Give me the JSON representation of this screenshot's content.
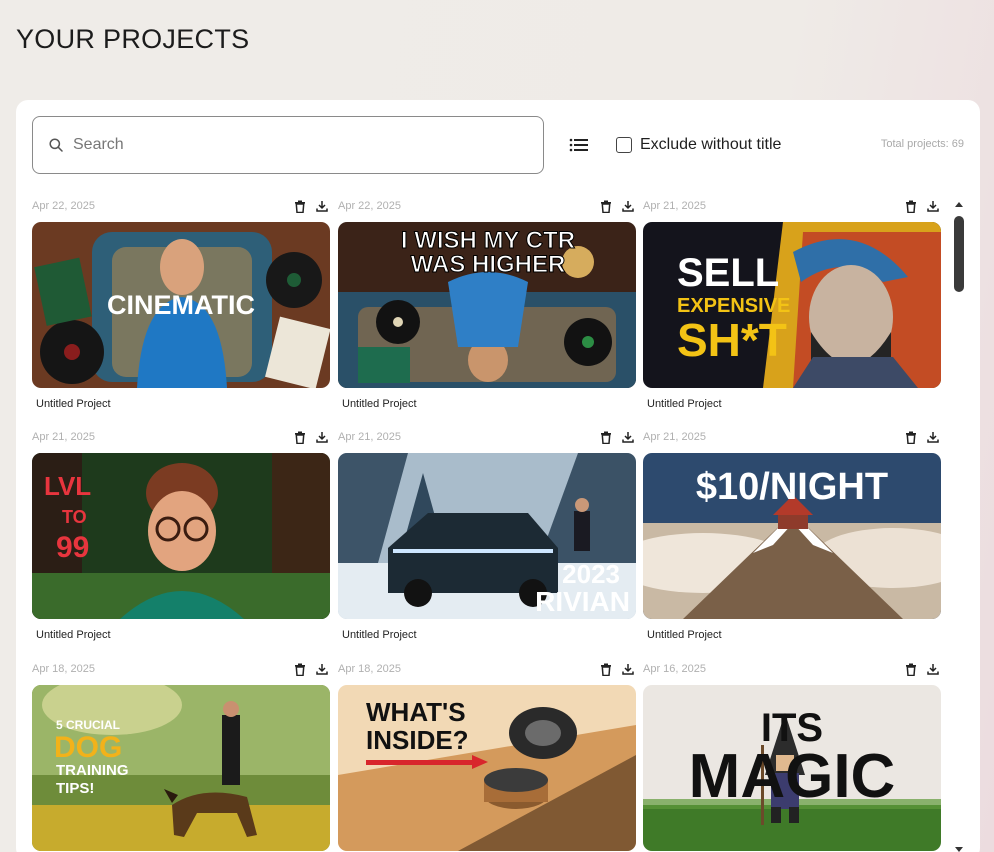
{
  "page": {
    "title": "YOUR PROJECTS"
  },
  "toolbar": {
    "search_placeholder": "Search",
    "exclude_label": "Exclude without title",
    "total_label": "Total projects:",
    "total_count": "69"
  },
  "projects": [
    {
      "date": "Apr 22, 2025",
      "title": "Untitled Project",
      "overlay": "CINEMATIC"
    },
    {
      "date": "Apr 22, 2025",
      "title": "Untitled Project",
      "overlay_line1": "I WISH MY CTR",
      "overlay_line2": "WAS HIGHER"
    },
    {
      "date": "Apr 21, 2025",
      "title": "Untitled Project",
      "overlay_line1": "SELL",
      "overlay_line2": "EXPENSIVE",
      "overlay_line3": "SH*T"
    },
    {
      "date": "Apr 21, 2025",
      "title": "Untitled Project",
      "overlay_line1": "LVL",
      "overlay_line2": "TO",
      "overlay_line3": "99"
    },
    {
      "date": "Apr 21, 2025",
      "title": "Untitled Project",
      "overlay_line1": "2023",
      "overlay_line2": "RIVIAN"
    },
    {
      "date": "Apr 21, 2025",
      "title": "Untitled Project",
      "overlay": "$10/NIGHT"
    },
    {
      "date": "Apr 18, 2025",
      "title": "",
      "overlay_line1": "5 CRUCIAL",
      "overlay_line2": "DOG",
      "overlay_line3": "TRAINING",
      "overlay_line4": "TIPS!"
    },
    {
      "date": "Apr 18, 2025",
      "title": "",
      "overlay_line1": "WHAT'S",
      "overlay_line2": "INSIDE?"
    },
    {
      "date": "Apr 16, 2025",
      "title": "",
      "overlay_line1": "ITS",
      "overlay_line2": "MAGIC"
    }
  ],
  "icons": {
    "search": "search-icon",
    "list_view": "list-view-icon",
    "delete": "trash-icon",
    "download": "download-icon"
  }
}
